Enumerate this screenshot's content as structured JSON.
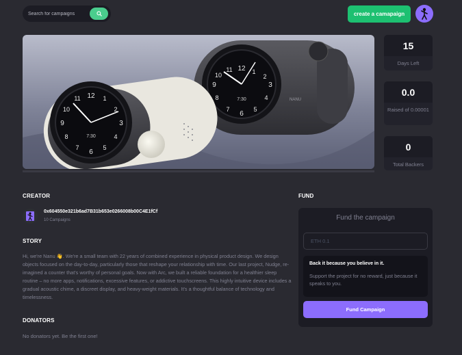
{
  "header": {
    "search_placeholder": "Search for campaigns",
    "create_label": "create a camapaign"
  },
  "stats": [
    {
      "value": "15",
      "label": "Days Left"
    },
    {
      "value": "0.0",
      "label": "Raised of 0.00001"
    },
    {
      "value": "0",
      "label": "Total Backers"
    }
  ],
  "creator": {
    "title": "CREATOR",
    "address": "0x604550e321b6ad7B31b653e0266008b00C4E1fCf",
    "campaigns": "10 Campaigns"
  },
  "story": {
    "title": "STORY",
    "text": "Hi, we're Nanu 👋. We're a small team with 22 years of combined experience in physical product design. We design objects focused on the day-to-day, particularly those that reshape your relationship with time. Our last project, Nudge, re-imagined a counter that's worthy of personal goals. Now with Arc, we built a reliable foundation for a healthier sleep routine – no more apps, notifications, excessive features, or addictive touchscreens. This highly intuitive device includes a gradual acoustic chime, a discreet display, and heavy-weight materials. It's a thoughtful balance of technology and timelessness."
  },
  "donators": {
    "title": "DONATORS",
    "empty": "No donators yet. Be the first one!"
  },
  "fund": {
    "title": "FUND",
    "card_title": "Fund the campaign",
    "input_placeholder": "ETH 0.1",
    "box_title": "Back it because you believe in it.",
    "box_text": "Support the project for no reward, just because it speaks to you.",
    "button_label": "Fund Campaign"
  },
  "hero_image": {
    "clock_time_text": "7:30",
    "brand_text": "NANU"
  },
  "colors": {
    "background": "#2a2a31",
    "card": "#1c1c24",
    "green": "#1dc071",
    "purple": "#8c6dfd",
    "muted": "#808191"
  }
}
